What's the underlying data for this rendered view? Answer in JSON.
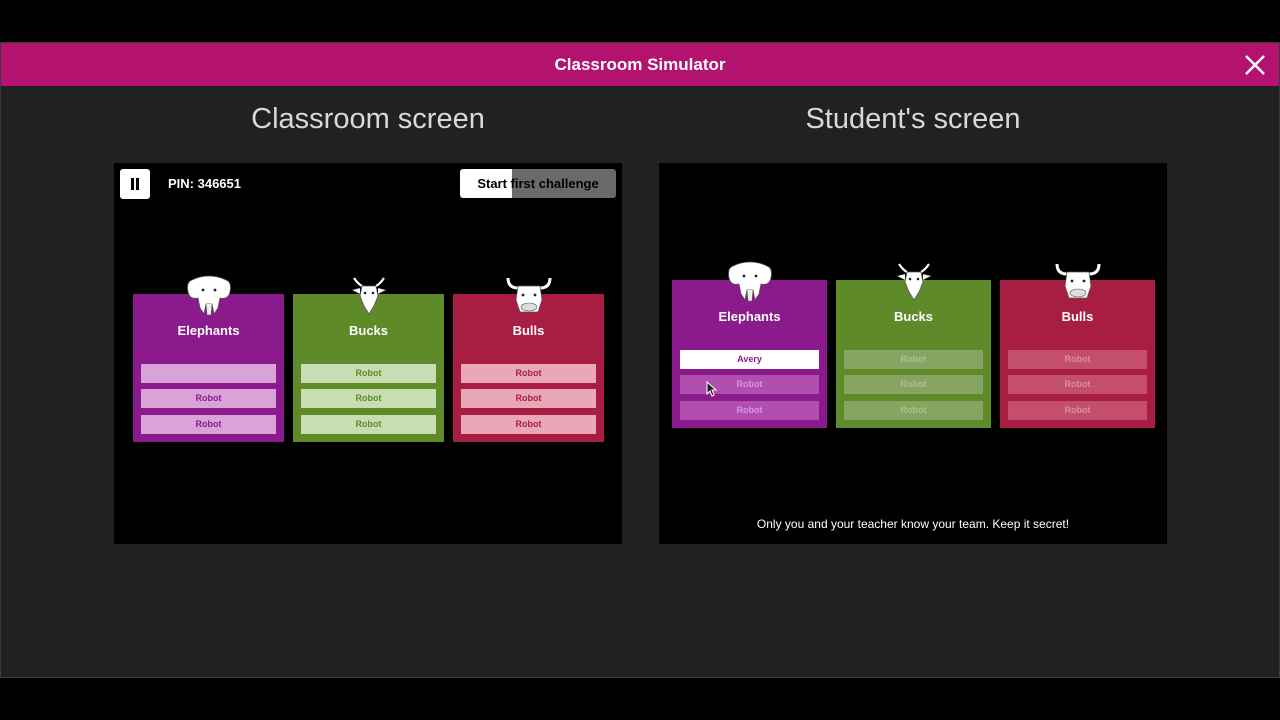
{
  "modal": {
    "title": "Classroom Simulator"
  },
  "classroom": {
    "title": "Classroom screen",
    "pin": "PIN: 346651",
    "start_button": "Start first challenge",
    "teams": [
      {
        "name": "Elephants",
        "icon": "elephant-icon",
        "color": "#8b1a8c",
        "slots": [
          "",
          "Robot",
          "Robot"
        ]
      },
      {
        "name": "Bucks",
        "icon": "buck-icon",
        "color": "#5e8a2a",
        "slots": [
          "Robot",
          "Robot",
          "Robot"
        ]
      },
      {
        "name": "Bulls",
        "icon": "bull-icon",
        "color": "#a81e43",
        "slots": [
          "Robot",
          "Robot",
          "Robot"
        ]
      }
    ]
  },
  "student": {
    "title": "Student's screen",
    "teams": [
      {
        "name": "Elephants",
        "icon": "elephant-icon",
        "color": "#8b1a8c",
        "slots": [
          "Avery",
          "Robot",
          "Robot"
        ]
      },
      {
        "name": "Bucks",
        "icon": "buck-icon",
        "color": "#5e8a2a",
        "slots": [
          "Robot",
          "Robot",
          "Robot"
        ]
      },
      {
        "name": "Bulls",
        "icon": "bull-icon",
        "color": "#a81e43",
        "slots": [
          "Robot",
          "Robot",
          "Robot"
        ]
      }
    ],
    "note": "Only you and your teacher know your team. Keep it secret!"
  },
  "colors": {
    "header": "#b3136e",
    "background": "#212121"
  }
}
